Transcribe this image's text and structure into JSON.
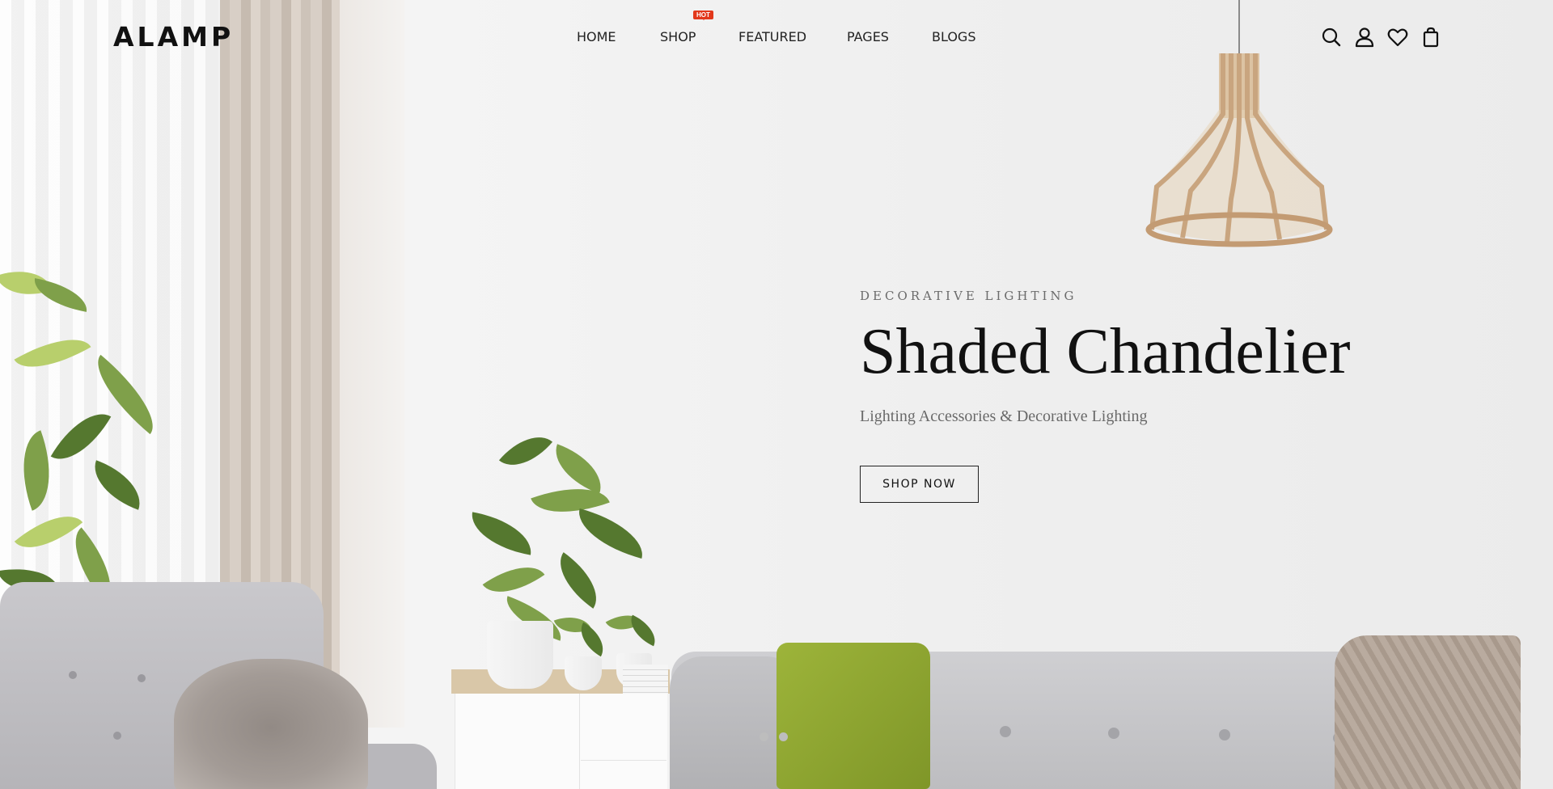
{
  "brand": {
    "logo_text": "ALAMP"
  },
  "nav": {
    "items": [
      {
        "label": "HOME"
      },
      {
        "label": "SHOP",
        "badge": "HOT"
      },
      {
        "label": "FEATURED"
      },
      {
        "label": "PAGES"
      },
      {
        "label": "BLOGS"
      }
    ]
  },
  "header_icons": [
    "search-icon",
    "user-icon",
    "heart-icon",
    "shopping-bag-icon"
  ],
  "hero": {
    "eyebrow": "DECORATIVE LIGHTING",
    "title": "Shaded Chandelier",
    "subtitle": "Lighting Accessories & Decorative Lighting",
    "cta_label": "SHOP NOW"
  },
  "slider": {
    "slides": 2,
    "active": 1
  },
  "colors": {
    "badge": "#e2381b",
    "text": "#111111",
    "accent_pillow": "#9db43a"
  }
}
